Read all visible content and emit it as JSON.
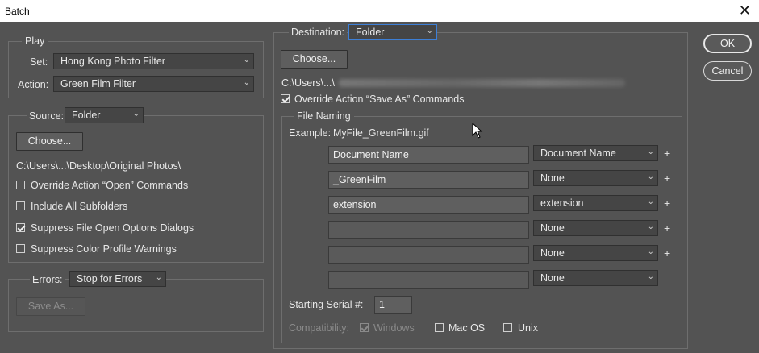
{
  "window": {
    "title": "Batch",
    "close_glyph": "✕"
  },
  "play": {
    "legend": "Play",
    "set_label": "Set:",
    "set_value": "Hong Kong Photo Filter",
    "action_label": "Action:",
    "action_value": "Green Film Filter"
  },
  "source": {
    "label": "Source:",
    "value": "Folder",
    "choose_label": "Choose...",
    "path": "C:\\Users\\...\\Desktop\\Original Photos\\",
    "options": [
      {
        "label": "Override Action “Open” Commands",
        "checked": false
      },
      {
        "label": "Include All Subfolders",
        "checked": false
      },
      {
        "label": "Suppress File Open Options Dialogs",
        "checked": true
      },
      {
        "label": "Suppress Color Profile Warnings",
        "checked": false
      }
    ]
  },
  "errors": {
    "label": "Errors:",
    "value": "Stop for Errors",
    "save_as_label": "Save As..."
  },
  "destination": {
    "label": "Destination:",
    "value": "Folder",
    "choose_label": "Choose...",
    "path_prefix": "C:\\Users\\...\\",
    "override_label": "Override Action “Save As” Commands",
    "override_checked": true
  },
  "file_naming": {
    "legend": "File Naming",
    "example_label": "Example:",
    "example_value": "MyFile_GreenFilm.gif",
    "rows": [
      {
        "text": "Document Name",
        "select": "Document Name",
        "plus": true
      },
      {
        "text": "_GreenFilm",
        "select": "None",
        "plus": true
      },
      {
        "text": "extension",
        "select": "extension",
        "plus": true
      },
      {
        "text": "",
        "select": "None",
        "plus": true
      },
      {
        "text": "",
        "select": "None",
        "plus": true
      },
      {
        "text": "",
        "select": "None",
        "plus": false
      }
    ],
    "serial_label": "Starting Serial #:",
    "serial_value": "1",
    "compat_label": "Compatibility:",
    "compat": [
      {
        "label": "Windows",
        "checked": true,
        "disabled": true
      },
      {
        "label": "Mac OS",
        "checked": false,
        "disabled": false
      },
      {
        "label": "Unix",
        "checked": false,
        "disabled": false
      }
    ]
  },
  "buttons": {
    "ok": "OK",
    "cancel": "Cancel"
  },
  "glyphs": {
    "caret": "⌄",
    "plus": "+"
  }
}
